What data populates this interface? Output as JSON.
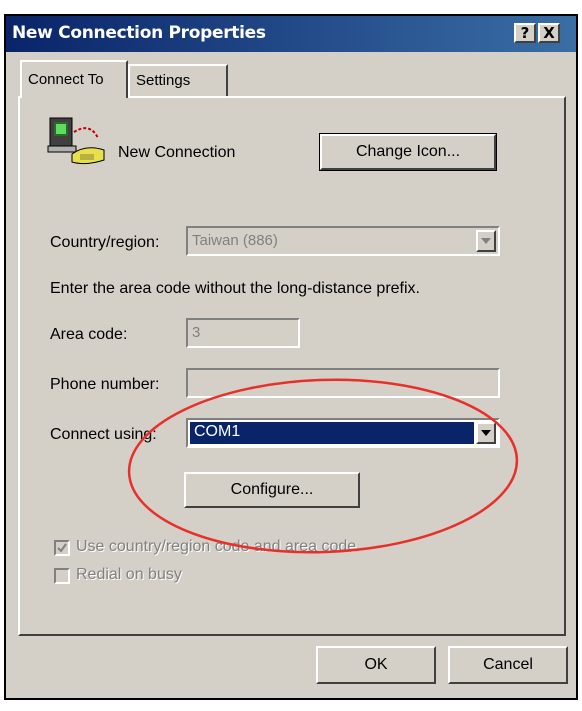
{
  "window": {
    "title": "New Connection Properties",
    "help_label": "?",
    "close_label": "X"
  },
  "tabs": [
    {
      "label": "Connect To"
    },
    {
      "label": "Settings"
    }
  ],
  "connection": {
    "name": "New Connection",
    "change_icon_label": "Change Icon..."
  },
  "country": {
    "label": "Country/region:",
    "value": "Taiwan (886)"
  },
  "instruction": "Enter the area code without the long-distance prefix.",
  "area_code": {
    "label": "Area code:",
    "value": "3"
  },
  "phone": {
    "label": "Phone number:",
    "value": ""
  },
  "connect_using": {
    "label": "Connect using:",
    "value": "COM1"
  },
  "configure_label": "Configure...",
  "checkboxes": [
    {
      "label": "Use country/region code and area code",
      "checked": true
    },
    {
      "label": "Redial on busy",
      "checked": false
    }
  ],
  "footer": {
    "ok_label": "OK",
    "cancel_label": "Cancel"
  },
  "colors": {
    "highlight": "#0a246a",
    "annotation": "#e8302a"
  }
}
